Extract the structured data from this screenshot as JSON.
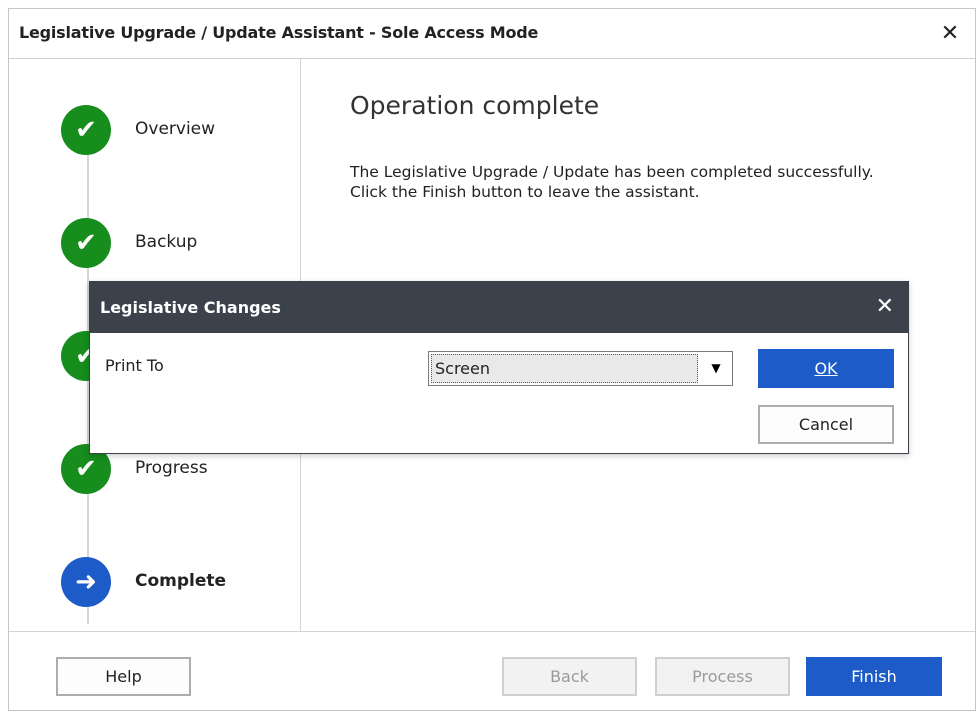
{
  "window": {
    "title": "Legislative Upgrade / Update Assistant - Sole Access Mode",
    "close_glyph": "✕"
  },
  "steps": [
    {
      "label": "Overview",
      "state": "done",
      "icon": "✔"
    },
    {
      "label": "Backup",
      "state": "done",
      "icon": "✔"
    },
    {
      "label": "",
      "state": "done",
      "icon": "✔"
    },
    {
      "label": "Progress",
      "state": "done",
      "icon": "✔"
    },
    {
      "label": "Complete",
      "state": "current",
      "icon": "➜"
    }
  ],
  "content": {
    "heading": "Operation complete",
    "line1": "The Legislative Upgrade / Update has been completed successfully.",
    "line2": "Click the Finish button to leave the assistant."
  },
  "footer": {
    "help": "Help",
    "back": "Back",
    "process": "Process",
    "finish": "Finish"
  },
  "dialog": {
    "title": "Legislative Changes",
    "close_glyph": "✕",
    "print_to_label": "Print To",
    "print_to_value": "Screen",
    "dropdown_arrow": "▼",
    "ok": "OK",
    "cancel": "Cancel"
  },
  "colors": {
    "done": "#168d1d",
    "current": "#1d5bc8",
    "primary": "#1d5bc8",
    "dialog_title_bg": "#3b424c"
  }
}
